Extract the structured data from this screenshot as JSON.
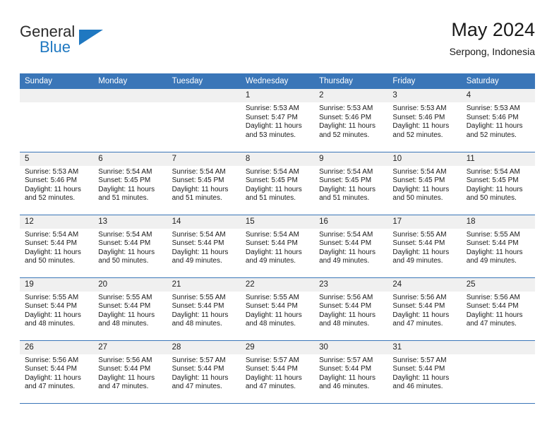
{
  "logo": {
    "primary_text": "General",
    "secondary_text": "Blue",
    "primary_color": "#2b2b2b",
    "accent_color": "#1f78c1"
  },
  "header": {
    "title": "May 2024",
    "subtitle": "Serpong, Indonesia"
  },
  "theme": {
    "header_blue": "#3a76b8",
    "daynum_bg": "#f0f0f0",
    "text": "#1a1a1a"
  },
  "weekdays": [
    "Sunday",
    "Monday",
    "Tuesday",
    "Wednesday",
    "Thursday",
    "Friday",
    "Saturday"
  ],
  "weeks": [
    [
      {
        "day": "",
        "sunrise": "",
        "sunset": "",
        "daylight": "",
        "daylight2": ""
      },
      {
        "day": "",
        "sunrise": "",
        "sunset": "",
        "daylight": "",
        "daylight2": ""
      },
      {
        "day": "",
        "sunrise": "",
        "sunset": "",
        "daylight": "",
        "daylight2": ""
      },
      {
        "day": "1",
        "sunrise": "Sunrise: 5:53 AM",
        "sunset": "Sunset: 5:47 PM",
        "daylight": "Daylight: 11 hours",
        "daylight2": "and 53 minutes."
      },
      {
        "day": "2",
        "sunrise": "Sunrise: 5:53 AM",
        "sunset": "Sunset: 5:46 PM",
        "daylight": "Daylight: 11 hours",
        "daylight2": "and 52 minutes."
      },
      {
        "day": "3",
        "sunrise": "Sunrise: 5:53 AM",
        "sunset": "Sunset: 5:46 PM",
        "daylight": "Daylight: 11 hours",
        "daylight2": "and 52 minutes."
      },
      {
        "day": "4",
        "sunrise": "Sunrise: 5:53 AM",
        "sunset": "Sunset: 5:46 PM",
        "daylight": "Daylight: 11 hours",
        "daylight2": "and 52 minutes."
      }
    ],
    [
      {
        "day": "5",
        "sunrise": "Sunrise: 5:53 AM",
        "sunset": "Sunset: 5:46 PM",
        "daylight": "Daylight: 11 hours",
        "daylight2": "and 52 minutes."
      },
      {
        "day": "6",
        "sunrise": "Sunrise: 5:54 AM",
        "sunset": "Sunset: 5:45 PM",
        "daylight": "Daylight: 11 hours",
        "daylight2": "and 51 minutes."
      },
      {
        "day": "7",
        "sunrise": "Sunrise: 5:54 AM",
        "sunset": "Sunset: 5:45 PM",
        "daylight": "Daylight: 11 hours",
        "daylight2": "and 51 minutes."
      },
      {
        "day": "8",
        "sunrise": "Sunrise: 5:54 AM",
        "sunset": "Sunset: 5:45 PM",
        "daylight": "Daylight: 11 hours",
        "daylight2": "and 51 minutes."
      },
      {
        "day": "9",
        "sunrise": "Sunrise: 5:54 AM",
        "sunset": "Sunset: 5:45 PM",
        "daylight": "Daylight: 11 hours",
        "daylight2": "and 51 minutes."
      },
      {
        "day": "10",
        "sunrise": "Sunrise: 5:54 AM",
        "sunset": "Sunset: 5:45 PM",
        "daylight": "Daylight: 11 hours",
        "daylight2": "and 50 minutes."
      },
      {
        "day": "11",
        "sunrise": "Sunrise: 5:54 AM",
        "sunset": "Sunset: 5:45 PM",
        "daylight": "Daylight: 11 hours",
        "daylight2": "and 50 minutes."
      }
    ],
    [
      {
        "day": "12",
        "sunrise": "Sunrise: 5:54 AM",
        "sunset": "Sunset: 5:44 PM",
        "daylight": "Daylight: 11 hours",
        "daylight2": "and 50 minutes."
      },
      {
        "day": "13",
        "sunrise": "Sunrise: 5:54 AM",
        "sunset": "Sunset: 5:44 PM",
        "daylight": "Daylight: 11 hours",
        "daylight2": "and 50 minutes."
      },
      {
        "day": "14",
        "sunrise": "Sunrise: 5:54 AM",
        "sunset": "Sunset: 5:44 PM",
        "daylight": "Daylight: 11 hours",
        "daylight2": "and 49 minutes."
      },
      {
        "day": "15",
        "sunrise": "Sunrise: 5:54 AM",
        "sunset": "Sunset: 5:44 PM",
        "daylight": "Daylight: 11 hours",
        "daylight2": "and 49 minutes."
      },
      {
        "day": "16",
        "sunrise": "Sunrise: 5:54 AM",
        "sunset": "Sunset: 5:44 PM",
        "daylight": "Daylight: 11 hours",
        "daylight2": "and 49 minutes."
      },
      {
        "day": "17",
        "sunrise": "Sunrise: 5:55 AM",
        "sunset": "Sunset: 5:44 PM",
        "daylight": "Daylight: 11 hours",
        "daylight2": "and 49 minutes."
      },
      {
        "day": "18",
        "sunrise": "Sunrise: 5:55 AM",
        "sunset": "Sunset: 5:44 PM",
        "daylight": "Daylight: 11 hours",
        "daylight2": "and 49 minutes."
      }
    ],
    [
      {
        "day": "19",
        "sunrise": "Sunrise: 5:55 AM",
        "sunset": "Sunset: 5:44 PM",
        "daylight": "Daylight: 11 hours",
        "daylight2": "and 48 minutes."
      },
      {
        "day": "20",
        "sunrise": "Sunrise: 5:55 AM",
        "sunset": "Sunset: 5:44 PM",
        "daylight": "Daylight: 11 hours",
        "daylight2": "and 48 minutes."
      },
      {
        "day": "21",
        "sunrise": "Sunrise: 5:55 AM",
        "sunset": "Sunset: 5:44 PM",
        "daylight": "Daylight: 11 hours",
        "daylight2": "and 48 minutes."
      },
      {
        "day": "22",
        "sunrise": "Sunrise: 5:55 AM",
        "sunset": "Sunset: 5:44 PM",
        "daylight": "Daylight: 11 hours",
        "daylight2": "and 48 minutes."
      },
      {
        "day": "23",
        "sunrise": "Sunrise: 5:56 AM",
        "sunset": "Sunset: 5:44 PM",
        "daylight": "Daylight: 11 hours",
        "daylight2": "and 48 minutes."
      },
      {
        "day": "24",
        "sunrise": "Sunrise: 5:56 AM",
        "sunset": "Sunset: 5:44 PM",
        "daylight": "Daylight: 11 hours",
        "daylight2": "and 47 minutes."
      },
      {
        "day": "25",
        "sunrise": "Sunrise: 5:56 AM",
        "sunset": "Sunset: 5:44 PM",
        "daylight": "Daylight: 11 hours",
        "daylight2": "and 47 minutes."
      }
    ],
    [
      {
        "day": "26",
        "sunrise": "Sunrise: 5:56 AM",
        "sunset": "Sunset: 5:44 PM",
        "daylight": "Daylight: 11 hours",
        "daylight2": "and 47 minutes."
      },
      {
        "day": "27",
        "sunrise": "Sunrise: 5:56 AM",
        "sunset": "Sunset: 5:44 PM",
        "daylight": "Daylight: 11 hours",
        "daylight2": "and 47 minutes."
      },
      {
        "day": "28",
        "sunrise": "Sunrise: 5:57 AM",
        "sunset": "Sunset: 5:44 PM",
        "daylight": "Daylight: 11 hours",
        "daylight2": "and 47 minutes."
      },
      {
        "day": "29",
        "sunrise": "Sunrise: 5:57 AM",
        "sunset": "Sunset: 5:44 PM",
        "daylight": "Daylight: 11 hours",
        "daylight2": "and 47 minutes."
      },
      {
        "day": "30",
        "sunrise": "Sunrise: 5:57 AM",
        "sunset": "Sunset: 5:44 PM",
        "daylight": "Daylight: 11 hours",
        "daylight2": "and 46 minutes."
      },
      {
        "day": "31",
        "sunrise": "Sunrise: 5:57 AM",
        "sunset": "Sunset: 5:44 PM",
        "daylight": "Daylight: 11 hours",
        "daylight2": "and 46 minutes."
      },
      {
        "day": "",
        "sunrise": "",
        "sunset": "",
        "daylight": "",
        "daylight2": ""
      }
    ]
  ]
}
